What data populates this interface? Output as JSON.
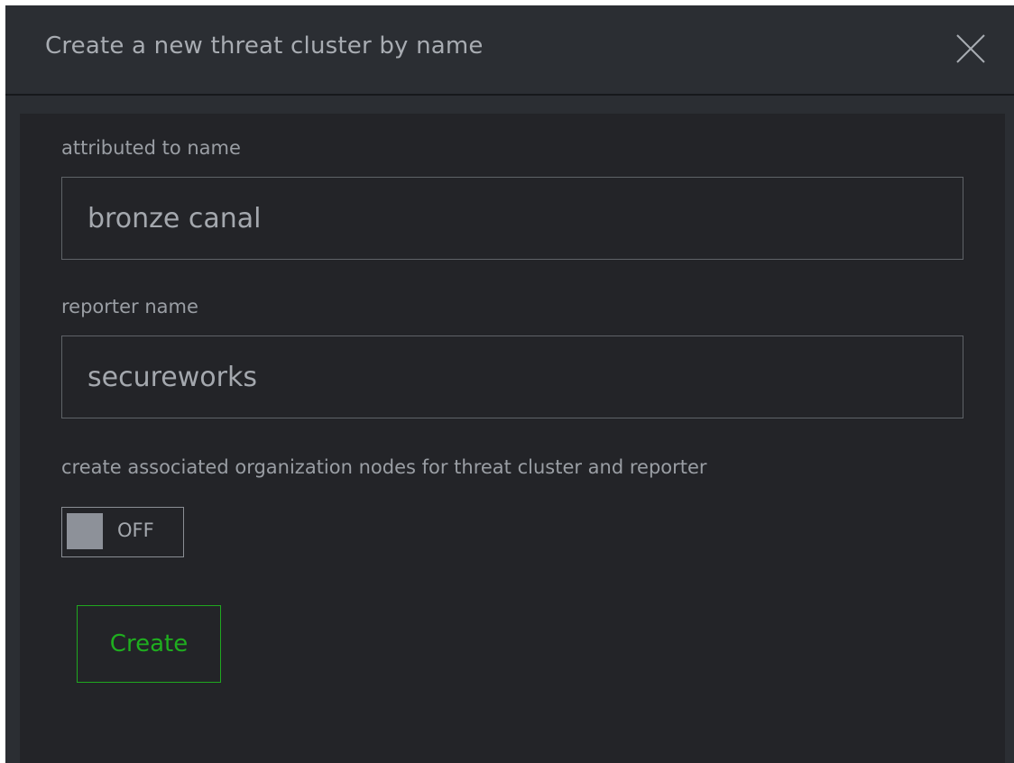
{
  "dialog": {
    "title": "Create a new threat cluster by name",
    "close_icon": "close-x-icon"
  },
  "form": {
    "attributed_label": "attributed to name",
    "attributed_value": "bronze canal",
    "reporter_label": "reporter name",
    "reporter_value": "secureworks",
    "toggle_label": "create associated organization nodes for threat cluster and reporter",
    "toggle_state": "OFF",
    "create_label": "Create"
  },
  "colors": {
    "header_bg": "#2b2e33",
    "body_bg": "#232428",
    "create_accent": "#1fae1f"
  }
}
